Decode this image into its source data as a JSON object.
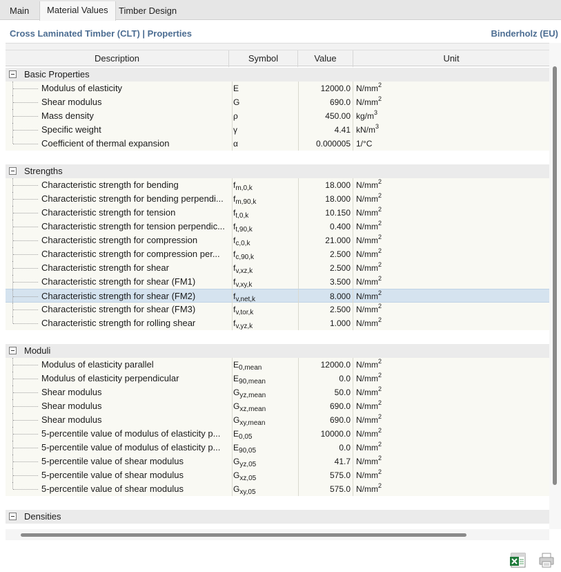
{
  "tabs": [
    {
      "label": "Main"
    },
    {
      "label": "Material Values"
    },
    {
      "label": "Timber Design"
    }
  ],
  "header": {
    "title": "Cross Laminated Timber (CLT) | Properties",
    "source": "Binderholz (EU)"
  },
  "columns": {
    "description": "Description",
    "symbol": "Symbol",
    "value": "Value",
    "unit": "Unit"
  },
  "groups": [
    {
      "label": "Basic Properties",
      "rows": [
        {
          "desc": "Modulus of elasticity",
          "sym": "E",
          "sub": "",
          "val": "12000.0",
          "unit": "N/mm",
          "sup": "2"
        },
        {
          "desc": "Shear modulus",
          "sym": "G",
          "sub": "",
          "val": "690.0",
          "unit": "N/mm",
          "sup": "2"
        },
        {
          "desc": "Mass density",
          "sym": "ρ",
          "sub": "",
          "val": "450.00",
          "unit": "kg/m",
          "sup": "3"
        },
        {
          "desc": "Specific weight",
          "sym": "γ",
          "sub": "",
          "val": "4.41",
          "unit": "kN/m",
          "sup": "3"
        },
        {
          "desc": "Coefficient of thermal expansion",
          "sym": "α",
          "sub": "",
          "val": "0.000005",
          "unit": "1/°C",
          "sup": ""
        }
      ]
    },
    {
      "label": "Strengths",
      "rows": [
        {
          "desc": "Characteristic strength for bending",
          "sym": "f",
          "sub": "m,0,k",
          "val": "18.000",
          "unit": "N/mm",
          "sup": "2"
        },
        {
          "desc": "Characteristic strength for bending perpendi...",
          "sym": "f",
          "sub": "m,90,k",
          "val": "18.000",
          "unit": "N/mm",
          "sup": "2"
        },
        {
          "desc": "Characteristic strength for tension",
          "sym": "f",
          "sub": "t,0,k",
          "val": "10.150",
          "unit": "N/mm",
          "sup": "2"
        },
        {
          "desc": "Characteristic strength for tension perpendic...",
          "sym": "f",
          "sub": "t,90,k",
          "val": "0.400",
          "unit": "N/mm",
          "sup": "2"
        },
        {
          "desc": "Characteristic strength for compression",
          "sym": "f",
          "sub": "c,0,k",
          "val": "21.000",
          "unit": "N/mm",
          "sup": "2"
        },
        {
          "desc": "Characteristic strength for compression per...",
          "sym": "f",
          "sub": "c,90,k",
          "val": "2.500",
          "unit": "N/mm",
          "sup": "2"
        },
        {
          "desc": "Characteristic strength for shear",
          "sym": "f",
          "sub": "v,xz,k",
          "val": "2.500",
          "unit": "N/mm",
          "sup": "2"
        },
        {
          "desc": "Characteristic strength for shear (FM1)",
          "sym": "f",
          "sub": "v,xy,k",
          "val": "3.500",
          "unit": "N/mm",
          "sup": "2"
        },
        {
          "desc": "Characteristic strength for shear (FM2)",
          "sym": "f",
          "sub": "v,net,k",
          "val": "8.000",
          "unit": "N/mm",
          "sup": "2",
          "selected": true
        },
        {
          "desc": "Characteristic strength for shear (FM3)",
          "sym": "f",
          "sub": "v,tor,k",
          "val": "2.500",
          "unit": "N/mm",
          "sup": "2"
        },
        {
          "desc": "Characteristic strength for rolling shear",
          "sym": "f",
          "sub": "v,yz,k",
          "val": "1.000",
          "unit": "N/mm",
          "sup": "2"
        }
      ]
    },
    {
      "label": "Moduli",
      "rows": [
        {
          "desc": "Modulus of elasticity parallel",
          "sym": "E",
          "sub": "0,mean",
          "val": "12000.0",
          "unit": "N/mm",
          "sup": "2"
        },
        {
          "desc": "Modulus of elasticity perpendicular",
          "sym": "E",
          "sub": "90,mean",
          "val": "0.0",
          "unit": "N/mm",
          "sup": "2"
        },
        {
          "desc": "Shear modulus",
          "sym": "G",
          "sub": "yz,mean",
          "val": "50.0",
          "unit": "N/mm",
          "sup": "2"
        },
        {
          "desc": "Shear modulus",
          "sym": "G",
          "sub": "xz,mean",
          "val": "690.0",
          "unit": "N/mm",
          "sup": "2"
        },
        {
          "desc": "Shear modulus",
          "sym": "G",
          "sub": "xy,mean",
          "val": "690.0",
          "unit": "N/mm",
          "sup": "2"
        },
        {
          "desc": "5-percentile value of modulus of elasticity p...",
          "sym": "E",
          "sub": "0,05",
          "val": "10000.0",
          "unit": "N/mm",
          "sup": "2"
        },
        {
          "desc": "5-percentile value of modulus of elasticity p...",
          "sym": "E",
          "sub": "90,05",
          "val": "0.0",
          "unit": "N/mm",
          "sup": "2"
        },
        {
          "desc": "5-percentile value of shear modulus",
          "sym": "G",
          "sub": "yz,05",
          "val": "41.7",
          "unit": "N/mm",
          "sup": "2"
        },
        {
          "desc": "5-percentile value of shear modulus",
          "sym": "G",
          "sub": "xz,05",
          "val": "575.0",
          "unit": "N/mm",
          "sup": "2"
        },
        {
          "desc": "5-percentile value of shear modulus",
          "sym": "G",
          "sub": "xy,05",
          "val": "575.0",
          "unit": "N/mm",
          "sup": "2"
        }
      ]
    },
    {
      "label": "Densities",
      "rows": []
    }
  ],
  "icons": {
    "export": "excel-export-icon",
    "print": "print-icon"
  }
}
